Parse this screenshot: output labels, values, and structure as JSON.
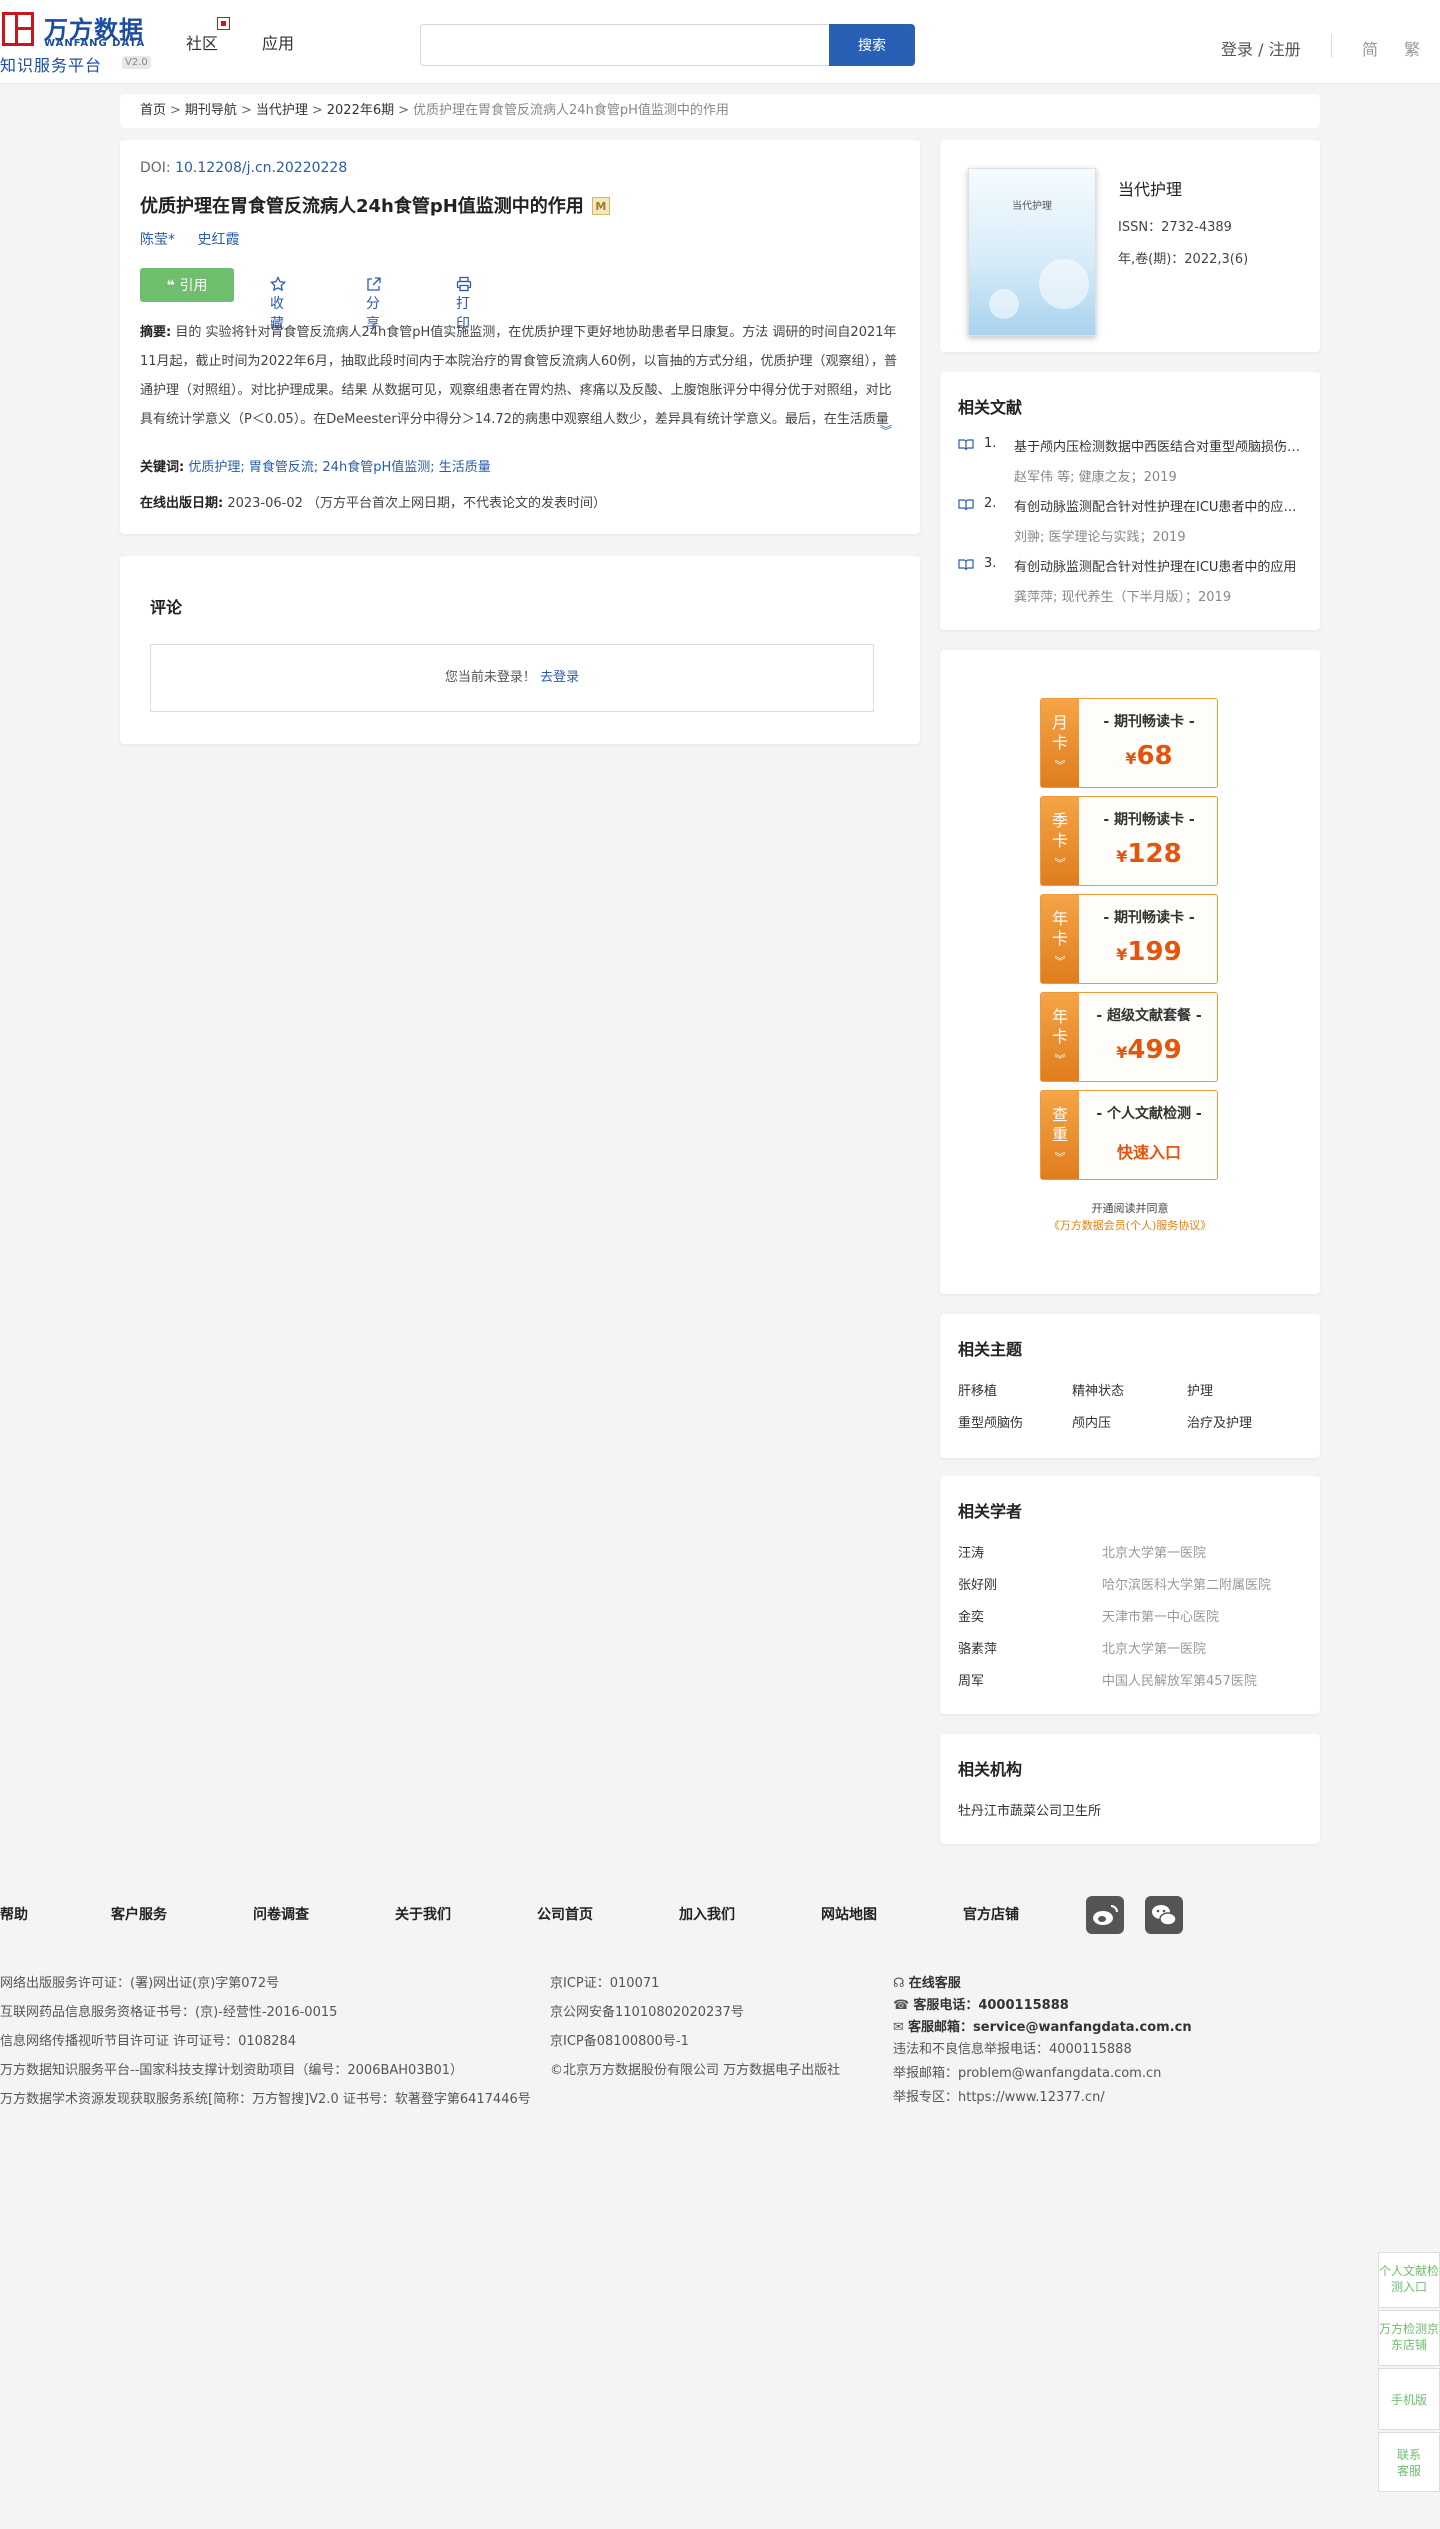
{
  "header": {
    "logo_cn": "万方数据",
    "logo_en": "WANFANG DATA",
    "logo_sub": "知识服务平台",
    "logo_ver": "V2.0",
    "nav": [
      "社区",
      "应用"
    ],
    "search_placeholder": "",
    "search_button": "搜索",
    "login": "登录 / 注册",
    "lang_simplified": "简",
    "lang_traditional": "繁"
  },
  "breadcrumb": {
    "items": [
      "首页",
      "期刊导航",
      "当代护理",
      "2022年6期"
    ],
    "current": "优质护理在胃食管反流病人24h食管pH值监测中的作用",
    "separator": ">"
  },
  "article": {
    "doi_label": "DOI:",
    "doi": "10.12208/j.cn.20220228",
    "title": "优质护理在胃食管反流病人24h食管pH值监测中的作用",
    "title_badge": "M",
    "authors": [
      "陈莹*",
      "史红霞"
    ],
    "cite_label": "引用",
    "collect_label": "收藏",
    "share_label": "分享",
    "print_label": "打印",
    "abstract_label": "摘要:",
    "abstract": "目的 实验将针对胃食管反流病人24h食管pH值实施监测，在优质护理下更好地协助患者早日康复。方法 调研的时间自2021年11月起，截止时间为2022年6月，抽取此段时间内于本院治疗的胃食管反流病人60例，以盲抽的方式分组，优质护理（观察组），普通护理（对照组）。对比护理成果。结果 从数据可见，观察组患者在胃灼热、疼痛以及反酸、上腹饱胀评分中得分优于对照组，对比具有统计学意义（P＜0.05）。在DeMeester评分中得分＞14.72的病患中观察组人数少，差异具有统计学意义。最后，在生活质量对比下可见观察组水平更高，差异显著。结论 采用优质护理对于胃食管反流患...",
    "keywords_label": "关键词:",
    "keywords": [
      "优质护理;",
      "胃食管反流;",
      "24h食管pH值监测;",
      "生活质量"
    ],
    "pubdate_label": "在线出版日期:",
    "pubdate": "2023-06-02",
    "pubdate_note": "（万方平台首次上网日期，不代表论文的发表时间）"
  },
  "comments": {
    "title": "评论",
    "not_logged": "您当前未登录！",
    "login_link": "去登录"
  },
  "journal": {
    "name": "当代护理",
    "cover_title": "当代护理",
    "issn": "ISSN：2732-4389",
    "volume": "年,卷(期)：2022,3(6)"
  },
  "related_docs": {
    "title": "相关文献",
    "items": [
      {
        "num": "1.",
        "title": "基于颅内压检测数据中西医结合对重型颅脑损伤患者的护理效果",
        "meta": "赵军伟 等;  健康之友；2019"
      },
      {
        "num": "2.",
        "title": "有创动脉监测配合针对性护理在ICU患者中的应用效果",
        "meta": "刘翀; 医学理论与实践；2019"
      },
      {
        "num": "3.",
        "title": "有创动脉监测配合针对性护理在ICU患者中的应用",
        "meta": "龚萍萍; 现代养生（下半月版）；2019"
      }
    ]
  },
  "packages": {
    "items": [
      {
        "tag1": "月",
        "tag2": "卡",
        "name": "- 期刊畅读卡 -",
        "currency": "¥",
        "price": "68"
      },
      {
        "tag1": "季",
        "tag2": "卡",
        "name": "- 期刊畅读卡 -",
        "currency": "¥",
        "price": "128"
      },
      {
        "tag1": "年",
        "tag2": "卡",
        "name": "- 期刊畅读卡 -",
        "currency": "¥",
        "price": "199"
      },
      {
        "tag1": "年",
        "tag2": "卡",
        "name": "- 超级文献套餐 -",
        "currency": "¥",
        "price": "499"
      },
      {
        "tag1": "查",
        "tag2": "重",
        "name": "- 个人文献检测 -",
        "link": "快速入口"
      }
    ],
    "agree_text": "开通阅读并同意",
    "agree_link": "《万方数据会员(个人)服务协议》"
  },
  "topics": {
    "title": "相关主题",
    "items": [
      "肝移植",
      "精神状态",
      "护理",
      "重型颅脑伤",
      "颅内压",
      "治疗及护理"
    ]
  },
  "scholars": {
    "title": "相关学者",
    "items": [
      {
        "name": "汪涛",
        "org": "北京大学第一医院"
      },
      {
        "name": "张好刚",
        "org": "哈尔滨医科大学第二附属医院"
      },
      {
        "name": "金奕",
        "org": "天津市第一中心医院"
      },
      {
        "name": "骆素萍",
        "org": "北京大学第一医院"
      },
      {
        "name": "周军",
        "org": "中国人民解放军第457医院"
      }
    ]
  },
  "institutions": {
    "title": "相关机构",
    "items": [
      "牡丹江市蔬菜公司卫生所"
    ]
  },
  "footer": {
    "nav": [
      "帮助",
      "客户服务",
      "问卷调查",
      "关于我们",
      "公司首页",
      "加入我们",
      "网站地图",
      "官方店铺"
    ],
    "col1": [
      "网络出版服务许可证：(署)网出证(京)字第072号",
      "互联网药品信息服务资格证书号：(京)-经营性-2016-0015",
      "信息网络传播视听节目许可证 许可证号：0108284",
      "万方数据知识服务平台--国家科技支撑计划资助项目（编号：2006BAH03B01）",
      "万方数据学术资源发现获取服务系统[简称：万方智搜]V2.0 证书号：软著登字第6417446号"
    ],
    "col2": [
      "京ICP证：010071",
      "京公网安备11010802020237号",
      "京ICP备08100800号-1",
      "©北京万方数据股份有限公司 万方数据电子出版社"
    ],
    "online_service": "在线客服",
    "phone_label": "客服电话：",
    "phone": "4000115888",
    "email_label": "客服邮箱：",
    "email": "service@wanfangdata.com.cn",
    "report_phone": "违法和不良信息举报电话：4000115888",
    "report_email": "举报邮箱：problem@wanfangdata.com.cn",
    "report_zone": "举报专区：https://www.12377.cn/"
  },
  "float_bar": {
    "items": [
      "个人文献检测入口",
      "万方检测京东店铺",
      "手机版",
      "联系客服"
    ]
  }
}
